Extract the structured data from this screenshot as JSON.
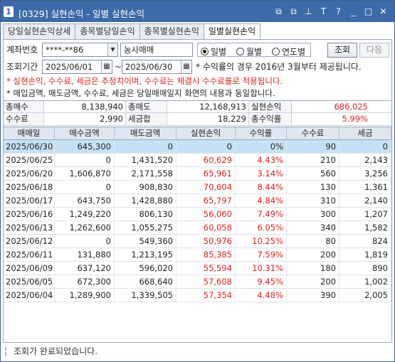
{
  "window": {
    "badge": "1",
    "title": "[0329] 실현손익 - 일별 실현손익",
    "icons": [
      "restore-icon",
      "copy-icon",
      "pin-icon",
      "text-icon",
      "help-icon",
      "minimize-icon",
      "maximize-icon",
      "close-icon"
    ],
    "icon_glyphs": [
      "⧉",
      "⧉",
      "⊥",
      "T",
      "?",
      "_",
      "□",
      "✕"
    ]
  },
  "tabs": [
    {
      "label": "당일실현손익상세",
      "active": false
    },
    {
      "label": "종목별당일손익",
      "active": false
    },
    {
      "label": "종목별실현손익",
      "active": false
    },
    {
      "label": "일별실현손익",
      "active": true
    }
  ],
  "filters": {
    "account_label": "계좌번호",
    "account_value": "****-**86",
    "account_name": "농사매매",
    "period_label": "조회기간",
    "date_from": "2025/06/01",
    "tilde": "~",
    "date_to": "2025/06/30",
    "radios": [
      {
        "label": "일별",
        "selected": true
      },
      {
        "label": "월별",
        "selected": false
      },
      {
        "label": "연도별",
        "selected": false
      }
    ],
    "search_button": "조회",
    "next_button": "다음",
    "rate_note": "* 수익률의 경우 2016년 3월부터 제공됩니다."
  },
  "notices": {
    "line1": "* 실현손익, 수수료, 세금은 추정치이며, 수수료는 체결시 수수료률로 적용됩니다.",
    "line2": "* 매입금액, 매도금액, 수수료, 세금은 당일매매일지 화면의 내용과 동일합니다."
  },
  "summary": {
    "buy_total_label": "총매수",
    "buy_total": "8,138,940",
    "sell_total_label": "총매도",
    "sell_total": "12,168,913",
    "realized_label": "실현손익",
    "realized": "686,025",
    "fee_label": "수수료",
    "fee": "2,990",
    "tax_label": "세금합",
    "tax": "18,229",
    "return_label": "총수익률",
    "return": "5.99%"
  },
  "table": {
    "headers": [
      "매매일",
      "매수금액",
      "매도금액",
      "실현손익",
      "수익률",
      "수수료",
      "세금"
    ],
    "rows": [
      [
        "2025/06/30",
        "645,300",
        "0",
        "0",
        "0%",
        "90",
        "0"
      ],
      [
        "2025/06/25",
        "0",
        "1,431,520",
        "60,629",
        "4.43%",
        "210",
        "2,143"
      ],
      [
        "2025/06/20",
        "1,606,870",
        "2,171,558",
        "65,961",
        "3.14%",
        "560",
        "3,256"
      ],
      [
        "2025/06/18",
        "0",
        "908,830",
        "70,604",
        "8.44%",
        "130",
        "1,361"
      ],
      [
        "2025/06/17",
        "643,750",
        "1,428,880",
        "65,797",
        "4.84%",
        "310",
        "2,140"
      ],
      [
        "2025/06/16",
        "1,249,220",
        "806,130",
        "56,060",
        "7.49%",
        "300",
        "1,207"
      ],
      [
        "2025/06/13",
        "1,262,600",
        "1,055,275",
        "60,058",
        "6.05%",
        "340",
        "1,582"
      ],
      [
        "2025/06/12",
        "0",
        "549,360",
        "50,976",
        "10.25%",
        "80",
        "824"
      ],
      [
        "2025/06/11",
        "131,880",
        "1,213,195",
        "85,385",
        "7.59%",
        "200",
        "1,819"
      ],
      [
        "2025/06/09",
        "637,120",
        "596,020",
        "55,594",
        "10.31%",
        "180",
        "890"
      ],
      [
        "2025/06/05",
        "672,300",
        "668,640",
        "57,608",
        "9.45%",
        "200",
        "1,002"
      ],
      [
        "2025/06/04",
        "1,289,900",
        "1,339,505",
        "57,354",
        "4.48%",
        "390",
        "2,005"
      ]
    ]
  },
  "status": "조회가 완료되었습니다.",
  "colors": {
    "title_bar": "#3d6aa8",
    "profit_red": "#e0201c",
    "selected_row": "#c6e1f5",
    "header_bg": "#dfe6f0"
  }
}
